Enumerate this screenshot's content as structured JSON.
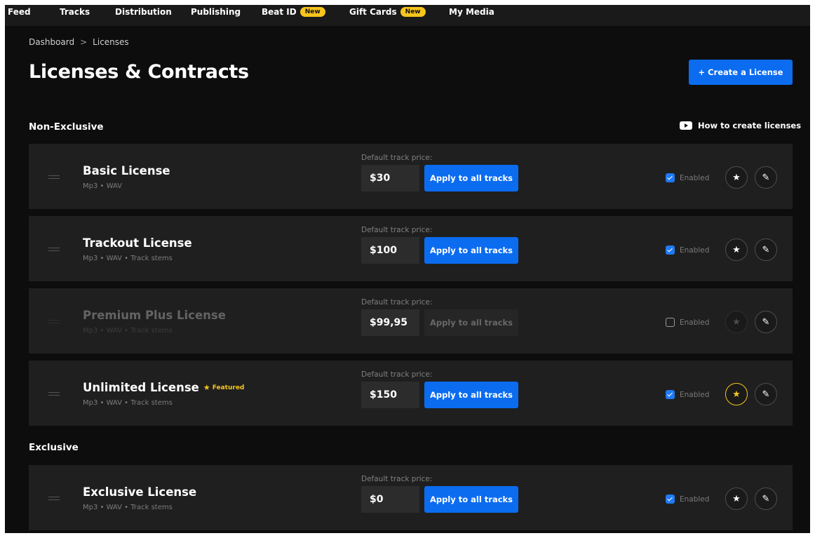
{
  "nav": {
    "items": [
      {
        "label": "Feed"
      },
      {
        "label": "Tracks"
      },
      {
        "label": "Distribution"
      },
      {
        "label": "Publishing"
      },
      {
        "label": "Beat ID",
        "badge": "New"
      },
      {
        "label": "Gift Cards",
        "badge": "New"
      },
      {
        "label": "My Media"
      }
    ]
  },
  "breadcrumb": {
    "root": "Dashboard",
    "separator": ">",
    "current": "Licenses"
  },
  "page": {
    "title": "Licenses & Contracts",
    "create_button": "+ Create a License"
  },
  "sections": {
    "non_exclusive": "Non-Exclusive",
    "exclusive": "Exclusive",
    "howto": "How to create licenses"
  },
  "licenses": [
    {
      "name": "Basic License",
      "files": "Mp3 • WAV",
      "price_label": "Default track price:",
      "price": "$30",
      "apply": "Apply to all tracks",
      "enabled_label": "Enabled",
      "enabled": true,
      "featured": false
    },
    {
      "name": "Trackout License",
      "files": "Mp3 • WAV • Track stems",
      "price_label": "Default track price:",
      "price": "$100",
      "apply": "Apply to all tracks",
      "enabled_label": "Enabled",
      "enabled": true,
      "featured": false
    },
    {
      "name": "Premium Plus License",
      "files": "Mp3 • WAV • Track stems",
      "price_label": "Default track price:",
      "price": "$99,95",
      "apply": "Apply to all tracks",
      "enabled_label": "Enabled",
      "enabled": false,
      "featured": false
    },
    {
      "name": "Unlimited License",
      "files": "Mp3 • WAV • Track stems",
      "price_label": "Default track price:",
      "price": "$150",
      "apply": "Apply to all tracks",
      "enabled_label": "Enabled",
      "enabled": true,
      "featured": true,
      "featured_label": "Featured"
    },
    {
      "name": "Exclusive License",
      "files": "Mp3 • WAV • Track stems",
      "price_label": "Default track price:",
      "price": "$0",
      "apply": "Apply to all tracks",
      "enabled_label": "Enabled",
      "enabled": true,
      "featured": false
    }
  ],
  "colors": {
    "accent": "#0b6cf0",
    "badge": "#f7c51c",
    "background": "#0d0d0d",
    "card": "#1f1f1f"
  },
  "icons": {
    "drag": "drag-handle-icon",
    "star": "star-icon",
    "edit": "pencil-icon",
    "video": "youtube-icon"
  }
}
